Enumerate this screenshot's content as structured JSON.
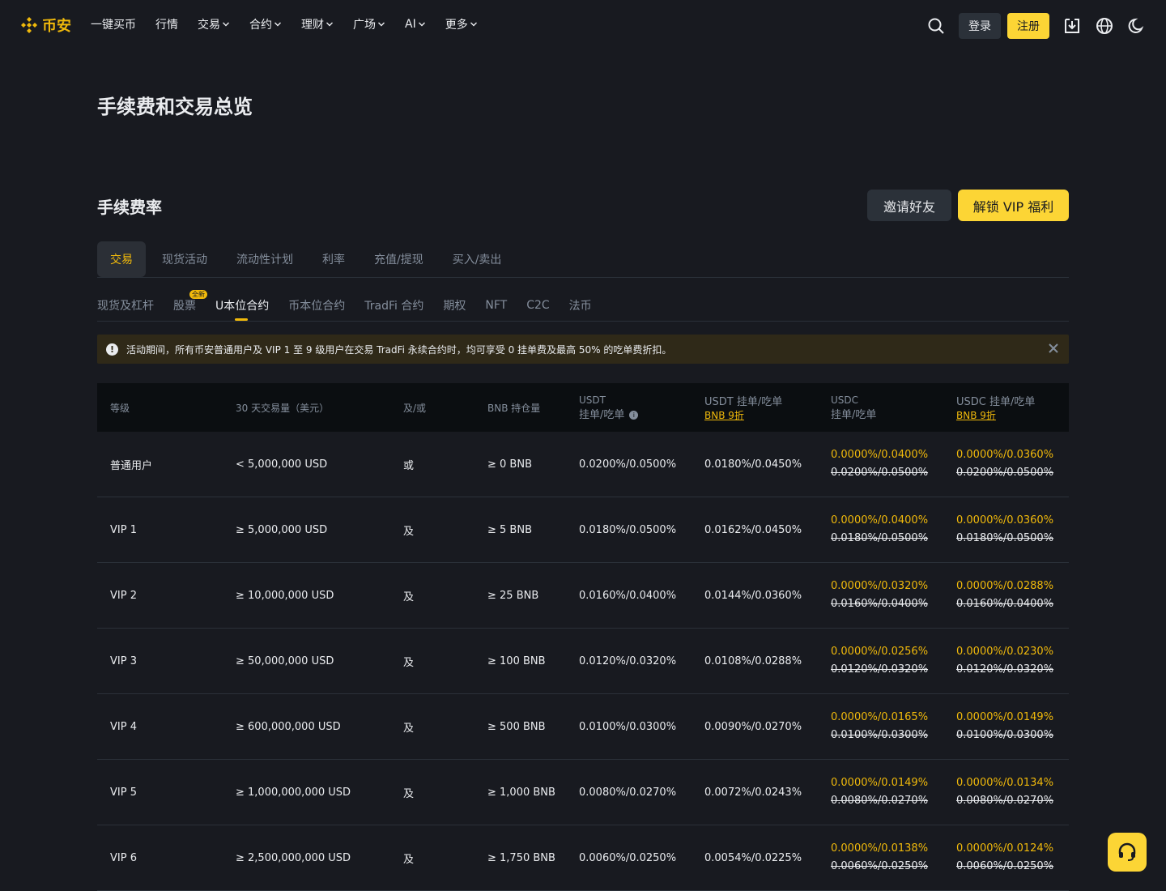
{
  "nav": {
    "logo_text": "币安",
    "menu": [
      {
        "label": "一键买币",
        "dropdown": false
      },
      {
        "label": "行情",
        "dropdown": false
      },
      {
        "label": "交易",
        "dropdown": true
      },
      {
        "label": "合约",
        "dropdown": true
      },
      {
        "label": "理财",
        "dropdown": true
      },
      {
        "label": "广场",
        "dropdown": true
      },
      {
        "label": "AI",
        "dropdown": true
      },
      {
        "label": "更多",
        "dropdown": true
      }
    ],
    "login": "登录",
    "register": "注册"
  },
  "page_title": "手续费和交易总览",
  "fees": {
    "title": "手续费率",
    "invite_button": "邀请好友",
    "vip_button": "解锁 VIP 福利"
  },
  "tabs_primary": [
    {
      "label": "交易",
      "active": true
    },
    {
      "label": "现货活动",
      "active": false
    },
    {
      "label": "流动性计划",
      "active": false
    },
    {
      "label": "利率",
      "active": false
    },
    {
      "label": "充值/提现",
      "active": false
    },
    {
      "label": "买入/卖出",
      "active": false
    }
  ],
  "tabs_secondary": [
    {
      "label": "现货及杠杆",
      "active": false,
      "badge": ""
    },
    {
      "label": "股票",
      "active": false,
      "badge": "全新"
    },
    {
      "label": "U本位合约",
      "active": true,
      "badge": ""
    },
    {
      "label": "币本位合约",
      "active": false,
      "badge": ""
    },
    {
      "label": "TradFi 合约",
      "active": false,
      "badge": ""
    },
    {
      "label": "期权",
      "active": false,
      "badge": ""
    },
    {
      "label": "NFT",
      "active": false,
      "badge": ""
    },
    {
      "label": "C2C",
      "active": false,
      "badge": ""
    },
    {
      "label": "法币",
      "active": false,
      "badge": ""
    }
  ],
  "notice": "活动期间，所有币安普通用户及 VIP 1 至 9 级用户在交易 TradFi 永续合约时，均可享受 0 挂单费及最高 50% 的吃单费折扣。",
  "table": {
    "headers": {
      "level": "等级",
      "volume": "30 天交易量（美元）",
      "andor": "及/或",
      "bnb": "BNB 持仓量",
      "usdt_top": "USDT",
      "usdt_sub": "挂单/吃单",
      "usdt_bnb_top": "USDT 挂单/吃单",
      "usdt_bnb_link": "BNB 9折",
      "usdc_top": "USDC",
      "usdc_sub": "挂单/吃单",
      "usdc_bnb_top": "USDC 挂单/吃单",
      "usdc_bnb_link": "BNB 9折"
    },
    "rows": [
      {
        "level": "普通用户",
        "volume": "< 5,000,000 USD",
        "andor": "或",
        "bnb": "≥ 0 BNB",
        "usdt": "0.0200%/0.0500%",
        "usdt_bnb": "0.0180%/0.0450%",
        "usdc_promo": "0.0000%/0.0400%",
        "usdc_orig": "0.0200%/0.0500%",
        "usdc_bnb_promo": "0.0000%/0.0360%",
        "usdc_bnb_orig": "0.0200%/0.0500%"
      },
      {
        "level": "VIP 1",
        "volume": "≥ 5,000,000 USD",
        "andor": "及",
        "bnb": "≥ 5 BNB",
        "usdt": "0.0180%/0.0500%",
        "usdt_bnb": "0.0162%/0.0450%",
        "usdc_promo": "0.0000%/0.0400%",
        "usdc_orig": "0.0180%/0.0500%",
        "usdc_bnb_promo": "0.0000%/0.0360%",
        "usdc_bnb_orig": "0.0180%/0.0500%"
      },
      {
        "level": "VIP 2",
        "volume": "≥ 10,000,000 USD",
        "andor": "及",
        "bnb": "≥ 25 BNB",
        "usdt": "0.0160%/0.0400%",
        "usdt_bnb": "0.0144%/0.0360%",
        "usdc_promo": "0.0000%/0.0320%",
        "usdc_orig": "0.0160%/0.0400%",
        "usdc_bnb_promo": "0.0000%/0.0288%",
        "usdc_bnb_orig": "0.0160%/0.0400%"
      },
      {
        "level": "VIP 3",
        "volume": "≥ 50,000,000 USD",
        "andor": "及",
        "bnb": "≥ 100 BNB",
        "usdt": "0.0120%/0.0320%",
        "usdt_bnb": "0.0108%/0.0288%",
        "usdc_promo": "0.0000%/0.0256%",
        "usdc_orig": "0.0120%/0.0320%",
        "usdc_bnb_promo": "0.0000%/0.0230%",
        "usdc_bnb_orig": "0.0120%/0.0320%"
      },
      {
        "level": "VIP 4",
        "volume": "≥ 600,000,000 USD",
        "andor": "及",
        "bnb": "≥ 500 BNB",
        "usdt": "0.0100%/0.0300%",
        "usdt_bnb": "0.0090%/0.0270%",
        "usdc_promo": "0.0000%/0.0165%",
        "usdc_orig": "0.0100%/0.0300%",
        "usdc_bnb_promo": "0.0000%/0.0149%",
        "usdc_bnb_orig": "0.0100%/0.0300%"
      },
      {
        "level": "VIP 5",
        "volume": "≥ 1,000,000,000 USD",
        "andor": "及",
        "bnb": "≥ 1,000 BNB",
        "usdt": "0.0080%/0.0270%",
        "usdt_bnb": "0.0072%/0.0243%",
        "usdc_promo": "0.0000%/0.0149%",
        "usdc_orig": "0.0080%/0.0270%",
        "usdc_bnb_promo": "0.0000%/0.0134%",
        "usdc_bnb_orig": "0.0080%/0.0270%"
      },
      {
        "level": "VIP 6",
        "volume": "≥ 2,500,000,000 USD",
        "andor": "及",
        "bnb": "≥ 1,750 BNB",
        "usdt": "0.0060%/0.0250%",
        "usdt_bnb": "0.0054%/0.0225%",
        "usdc_promo": "0.0000%/0.0138%",
        "usdc_orig": "0.0060%/0.0250%",
        "usdc_bnb_promo": "0.0000%/0.0124%",
        "usdc_bnb_orig": "0.0060%/0.0250%"
      }
    ]
  },
  "colors": {
    "accent": "#F0B90B",
    "button_yellow": "#FCD535",
    "background": "#181A20",
    "panel": "#2B3139"
  },
  "icons": [
    "binance-logo-icon",
    "search-icon",
    "download-icon",
    "globe-icon",
    "moon-icon",
    "warning-icon",
    "close-icon",
    "info-icon",
    "headset-icon"
  ]
}
